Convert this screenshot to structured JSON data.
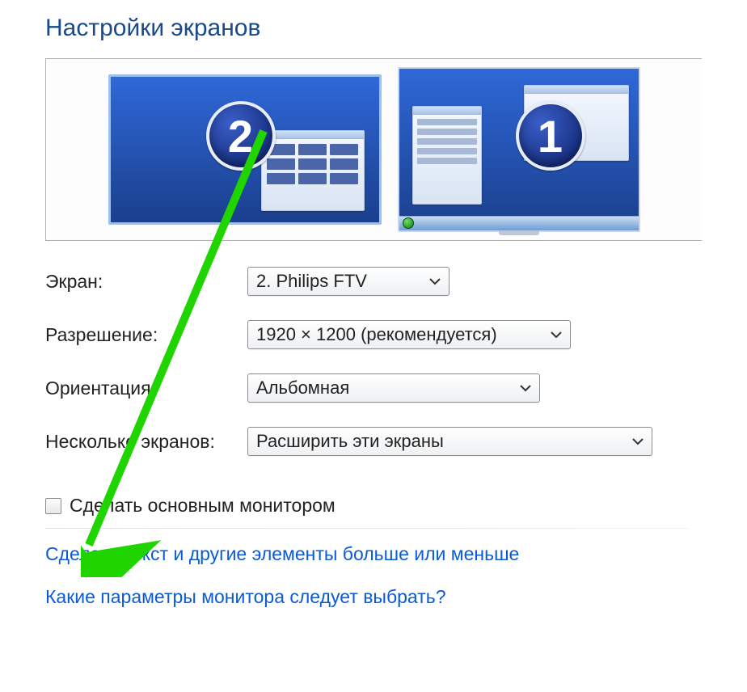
{
  "title": "Настройки экранов",
  "monitors": {
    "selected_badge": "2",
    "other_badge": "1"
  },
  "form": {
    "screen": {
      "label": "Экран:",
      "value": "2. Philips FTV"
    },
    "resolution": {
      "label": "Разрешение:",
      "value": "1920 × 1200 (рекомендуется)"
    },
    "orientation": {
      "label": "Ориентация:",
      "value": "Альбомная"
    },
    "multiple": {
      "label": "Несколько экранов:",
      "value": "Расширить эти экраны"
    }
  },
  "checkbox": {
    "label": "Сделать основным монитором",
    "checked": false
  },
  "links": {
    "textsize": "Сделать текст и другие элементы больше или меньше",
    "helpparams": "Какие параметры монитора следует выбрать?"
  },
  "annotation": {
    "color": "#20d400"
  }
}
